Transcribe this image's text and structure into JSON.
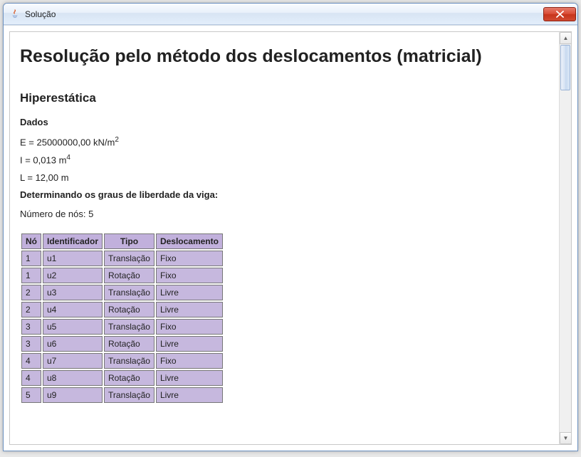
{
  "window": {
    "title": "Solução"
  },
  "page": {
    "title": "Resolução pelo método dos deslocamentos (matricial)",
    "section": "Hiperestática",
    "dados_heading": "Dados",
    "E_line_prefix": "E = 25000000,00 kN/m",
    "E_exp": "2",
    "I_line_prefix": "I = 0,013 m",
    "I_exp": "4",
    "L_line": "L = 12,00 m",
    "dof_heading": "Determinando os graus de liberdade da viga:",
    "nodes_line": "Número de nós: 5"
  },
  "table": {
    "headers": {
      "no": "Nó",
      "id": "Identificador",
      "tipo": "Tipo",
      "desl": "Deslocamento"
    },
    "rows": [
      {
        "no": "1",
        "id": "u1",
        "tipo": "Translação",
        "desl": "Fixo"
      },
      {
        "no": "1",
        "id": "u2",
        "tipo": "Rotação",
        "desl": "Fixo"
      },
      {
        "no": "2",
        "id": "u3",
        "tipo": "Translação",
        "desl": "Livre"
      },
      {
        "no": "2",
        "id": "u4",
        "tipo": "Rotação",
        "desl": "Livre"
      },
      {
        "no": "3",
        "id": "u5",
        "tipo": "Translação",
        "desl": "Fixo"
      },
      {
        "no": "3",
        "id": "u6",
        "tipo": "Rotação",
        "desl": "Livre"
      },
      {
        "no": "4",
        "id": "u7",
        "tipo": "Translação",
        "desl": "Fixo"
      },
      {
        "no": "4",
        "id": "u8",
        "tipo": "Rotação",
        "desl": "Livre"
      },
      {
        "no": "5",
        "id": "u9",
        "tipo": "Translação",
        "desl": "Livre"
      }
    ]
  }
}
